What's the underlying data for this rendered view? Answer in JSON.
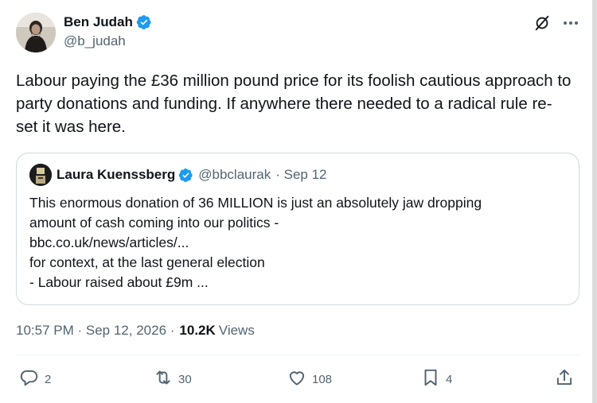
{
  "author": {
    "display_name": "Ben Judah",
    "handle": "@b_judah",
    "verified": true
  },
  "tweet_text": "Labour paying the £36 million pound price for its foolish cautious approach to party donations and funding. If anywhere there needed to a radical rule re-set it was here.",
  "quote": {
    "display_name": "Laura Kuenssberg",
    "handle": "@bbclaurak",
    "date": "· Sep 12",
    "lines": [
      "This enormous donation of 36 MILLION is just an absolutely jaw dropping",
      "amount of cash coming into our politics -",
      "bbc.co.uk/news/articles/...",
      "for context, at the last general election",
      "- Labour raised about £9m ..."
    ]
  },
  "meta": {
    "time_date": "10:57 PM · Sep 12, 2026 ·",
    "views_count": "10.2K",
    "views_label": "Views"
  },
  "actions": {
    "replies": "2",
    "reposts": "30",
    "likes": "108",
    "bookmarks": "4"
  },
  "colors": {
    "verified_blue": "#1d9bf0",
    "secondary_text": "#536471",
    "primary_text": "#0f1419",
    "border": "#cfd9de"
  },
  "icons": [
    "grok-icon",
    "more-icon",
    "reply-icon",
    "repost-icon",
    "like-icon",
    "bookmark-icon",
    "share-icon"
  ]
}
